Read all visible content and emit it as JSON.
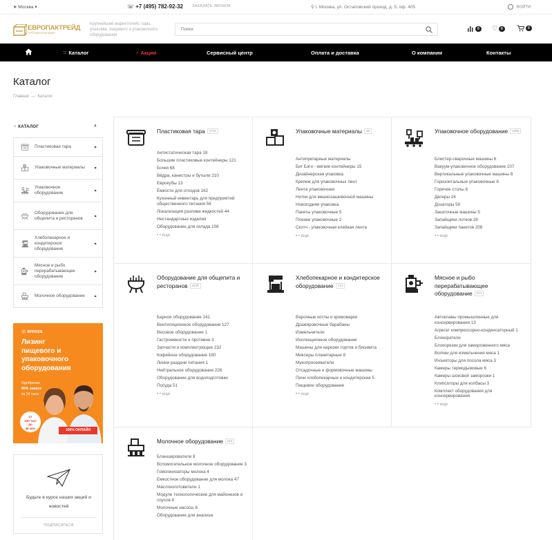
{
  "topbar": {
    "city": "Москва",
    "phone": "+7 (495) 782-92-32",
    "callback": "ЗАКАЗАТЬ ЗВОНОК",
    "address": "г. Москва, ул. Остаповский проезд, д. 5, оф. 405",
    "login": "ВОЙТИ"
  },
  "header": {
    "logo": "ЕВРОПАКТРЕЙД",
    "logo_sub": "ТОРГОВАЯ КОМПАНИЯ",
    "tagline": "Крупнейший маркетплейс тары, упаковки, пищевого и упаковочного оборудования",
    "search_placeholder": "Поиск",
    "compare_count": "0",
    "favorites_count": "0",
    "cart_count": "0"
  },
  "nav": {
    "catalog": "Каталог",
    "sales": "Акции",
    "service": "Сервисный центр",
    "delivery": "Оплата и доставка",
    "about": "О компании",
    "contacts": "Контакты"
  },
  "page": {
    "title": "Каталог",
    "breadcrumb_home": "Главная",
    "breadcrumb_sep": "—",
    "breadcrumb_current": "Каталог"
  },
  "sidebar": {
    "heading": "КАТАЛОГ",
    "items": [
      {
        "label": "Пластиковая тара"
      },
      {
        "label": "Упаковочные материалы"
      },
      {
        "label": "Упаковочное оборудование"
      },
      {
        "label": "Оборудование для общепита и ресторанов"
      },
      {
        "label": "Хлебопекарное и кондитерское оборудование"
      },
      {
        "label": "Мясное и рыбо перерабатывающее оборудование"
      },
      {
        "label": "Молочное оборудование"
      }
    ]
  },
  "banner": {
    "brand": "arenza",
    "title_1": "Лизинг",
    "title_2": "пищевого и",
    "title_3": "упаковочного",
    "title_4": "оборудования",
    "line1": "Одобрение",
    "line2": "80% заявок",
    "line3": "за 24 часа",
    "sticker_1": "от",
    "sticker_2": "100 тыс",
    "sticker_3": "до",
    "sticker_4": "36 мес",
    "online": "100% ОНЛАЙН"
  },
  "subscribe": {
    "text": "Будьте в курсе наших акций и новостей",
    "button": "ПОДПИСАТЬСЯ"
  },
  "more_label": "еще",
  "categories": [
    {
      "title": "Пластиковая тара",
      "count": "1715",
      "items": [
        "Антистатическая тара 18",
        "Большие пластиковые контейнеры 121",
        "Бочки 68",
        "Вёдра, канистры и бутыли 210",
        "Еврокубы 13",
        "Ёмкости для отходов 162",
        "Кухонный инвентарь для предприятий общественного питания 56",
        "Локализация разлива жидкостей 44",
        "Нестандартные изделия",
        "Оборудование для склада 106"
      ]
    },
    {
      "title": "Упаковочные материалы",
      "count": "22",
      "items": [
        "Антипригарные материалы",
        "Биг Бэги - мягкие контейнеры 15",
        "Дизайнерская упаковка",
        "Крепеж для упаковочных лент",
        "Лента упаковочная",
        "Нитки для мешкозашивочной машины",
        "Новогодняя упаковка",
        "Пакеты упаковочные 5",
        "Пленки упаковочные 2",
        "Скотч - упаковочная клейкая лента"
      ]
    },
    {
      "title": "Упаковочное оборудование",
      "count": "1458",
      "items": [
        "Блистер-сварочные машины 6",
        "Вакуум-упаковочное оборудование 107",
        "Вертикальные упаковочные машины 8",
        "Горизонтальные упаковочные 8",
        "Горячие столы 6",
        "Датеры 16",
        "Дозаторы 59",
        "Закаточные машины 5",
        "Запайщики лотков 28",
        "Запайщики пакетов 208"
      ]
    },
    {
      "title": "Оборудование для общепита и ресторанов",
      "count": "2239",
      "items": [
        "Барное оборудование 141",
        "Вентиляционное оборудование 127",
        "Весовое оборудование 1",
        "Гастроемкости и противни 3",
        "Запчасти и комплектующие 232",
        "Кофейное оборудование 180",
        "Линии раздачи питания 1",
        "Нейтральное оборудование 226",
        "Оборудование для водоподготовки",
        "Посуда 51"
      ]
    },
    {
      "title": "Хлебопекарное и кондитерское оборудование",
      "count": "714",
      "items": [
        "Варочные котлы и кремоварки",
        "Дражировочные барабаны",
        "Измельчители",
        "Инспекционное оборудование",
        "Машины для нарезки тортов и бисквита",
        "Миксеры планетарные 9",
        "Мукопросеиватели",
        "Отсадочные и формовочные машины",
        "Печи хлебопекарные и кондитерские 5",
        "Пищевое оборудование"
      ]
    },
    {
      "title": "Мясное и рыбо перерабатывающее оборудование",
      "count": "214",
      "items": [
        "Автоклавы промышленные для консервирования 13",
        "Агрегат компрессорно-конденсаторный 1",
        "Блокиратели",
        "Блокорезки для замороженного мяса",
        "Волчки для измельчения мяса 1",
        "Инъекторы для посола мяса 3",
        "Камеры термодымовые 6",
        "Камеры шоковой заморозки 1",
        "Клипсаторы для колбасы 3",
        "Комплект оборудования для консервирования"
      ]
    },
    {
      "title": "Молочное оборудование",
      "count": "213",
      "items": [
        "Бланширователи 8",
        "Вспомогательное молочное оборудование 3",
        "Гомогенизаторы молока 4",
        "Емкостное оборудование для молока 47",
        "Маслоизготовители 1",
        "Модули технологические для майонезов и соусов 8",
        "Молочные насосы 6",
        "Оборудование для анализа"
      ]
    }
  ],
  "colors": {
    "nav_bg": "#000000",
    "accent_red": "#e8392b",
    "brand_gold": "#c9a24a",
    "banner_orange": "#f68a1e"
  }
}
